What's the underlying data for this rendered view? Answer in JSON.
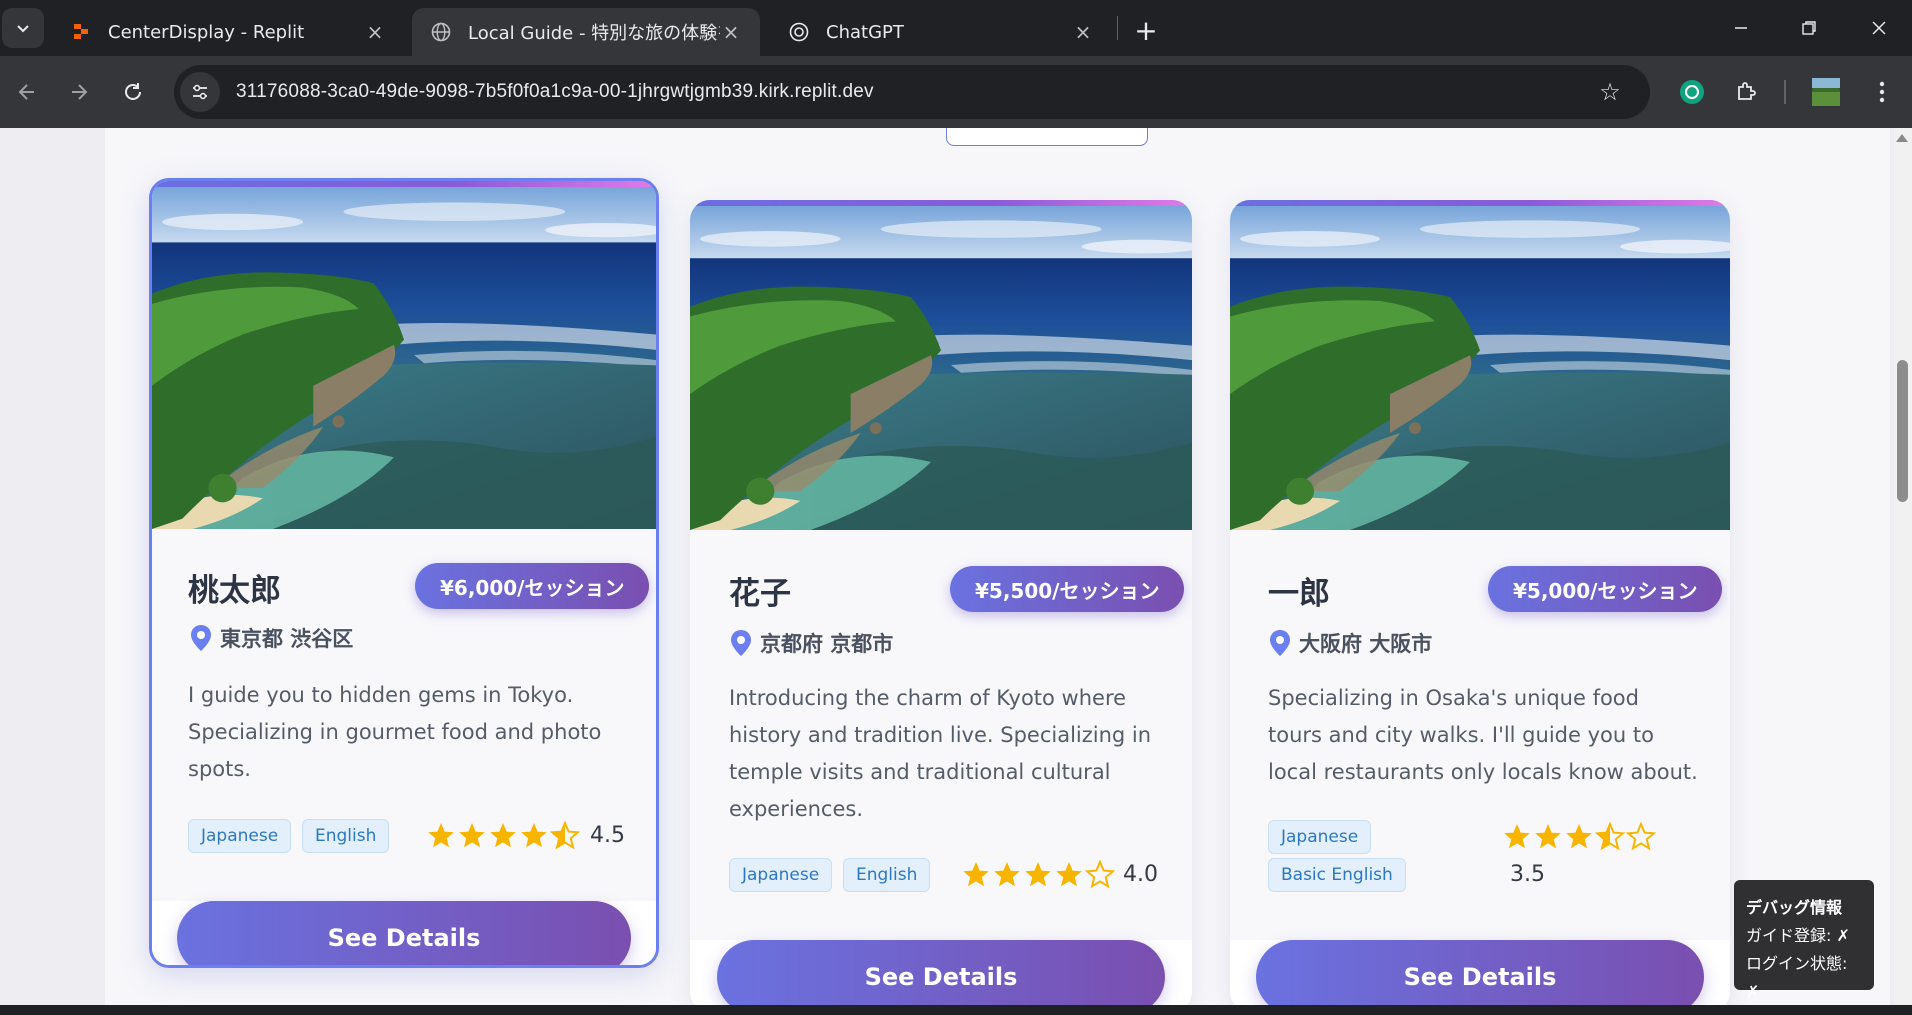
{
  "browser": {
    "tabs": [
      {
        "title": "CenterDisplay - Replit",
        "icon": "replit-icon"
      },
      {
        "title": "Local Guide - 特別な旅の体験を",
        "icon": "globe-icon"
      },
      {
        "title": "ChatGPT",
        "icon": "chatgpt-icon"
      }
    ],
    "active_tab": 1,
    "url": "31176088-3ca0-49de-9098-7b5f0f0a1c9a-00-1jhrgwtjgmb39.kirk.replit.dev"
  },
  "guides": [
    {
      "name": "桃太郎",
      "price": "¥6,000/セッション",
      "location": "東京都 渋谷区",
      "description": "I guide you to hidden gems in Tokyo. Specializing in gourmet food and photo spots.",
      "languages": [
        "Japanese",
        "English"
      ],
      "rating": 4.5,
      "rating_text": "4.5",
      "button": "See Details"
    },
    {
      "name": "花子",
      "price": "¥5,500/セッション",
      "location": "京都府 京都市",
      "description": "Introducing the charm of Kyoto where history and tradition live. Specializing in temple visits and traditional cultural experiences.",
      "languages": [
        "Japanese",
        "English"
      ],
      "rating": 4.0,
      "rating_text": "4.0",
      "button": "See Details"
    },
    {
      "name": "一郎",
      "price": "¥5,000/セッション",
      "location": "大阪府 大阪市",
      "description": "Specializing in Osaka's unique food tours and city walks. I'll guide you to local restaurants only locals know about.",
      "languages": [
        "Japanese",
        "Basic English"
      ],
      "rating": 3.5,
      "rating_text": "3.5",
      "button": "See Details"
    }
  ],
  "debug": {
    "title": "デバッグ情報",
    "guide_registered": "ガイド登録: ✗",
    "login_status": "ログイン状態: ✗"
  },
  "colors": {
    "accent_start": "#6a72e0",
    "accent_end": "#7a4fb0",
    "star": "#f7b500",
    "lang_tag_bg": "#e3f0fb",
    "lang_tag_text": "#2c77c4"
  }
}
